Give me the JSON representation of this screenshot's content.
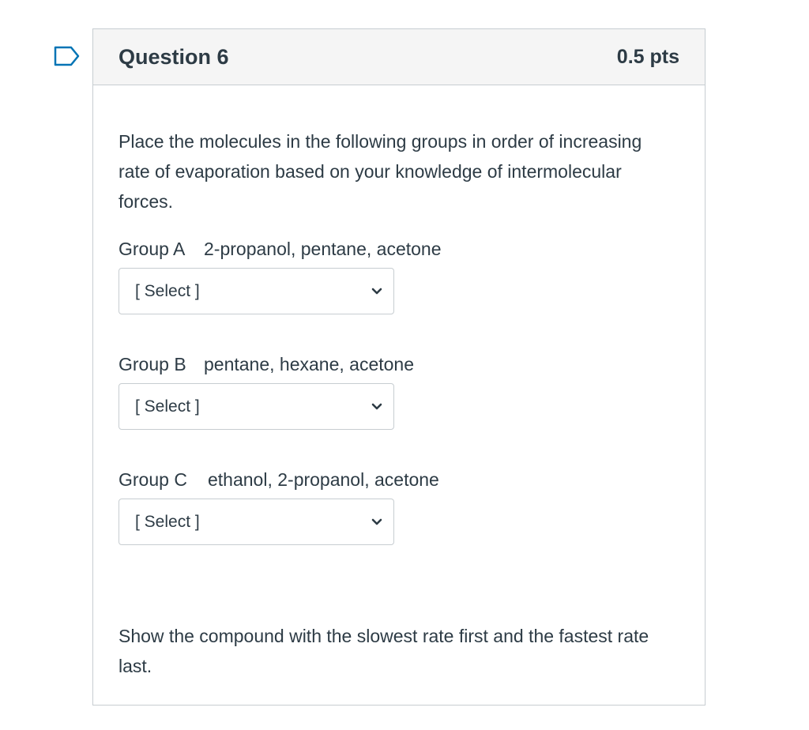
{
  "question": {
    "title": "Question 6",
    "points": "0.5 pts",
    "intro": "Place the molecules in the following groups in order of increasing rate of evaporation based on your knowledge of intermolecular forces.",
    "groups": [
      {
        "name": "Group A",
        "molecules": "2-propanol, pentane, acetone",
        "select_value": "[ Select ]"
      },
      {
        "name": "Group B",
        "molecules": "pentane, hexane, acetone",
        "select_value": "[ Select ]"
      },
      {
        "name": "Group C",
        "molecules": "ethanol, 2-propanol, acetone",
        "select_value": "[ Select ]"
      }
    ],
    "footer": "Show the compound with the slowest rate first and the fastest rate last."
  },
  "colors": {
    "accent": "#0374b5",
    "border": "#c7cdd1",
    "header_bg": "#f5f5f5",
    "text": "#2d3b45"
  },
  "icons": {
    "flag": "flag-outline-icon",
    "chevron": "chevron-down-icon"
  }
}
